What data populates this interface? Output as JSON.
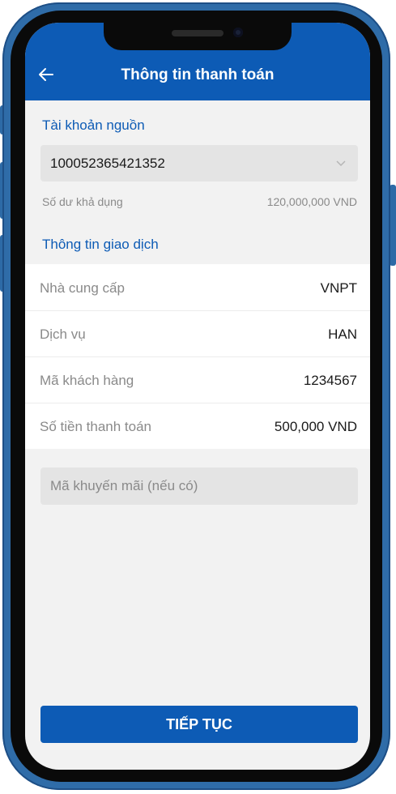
{
  "header": {
    "title": "Thông tin thanh toán",
    "back_icon": "back-arrow-icon"
  },
  "source_account": {
    "section_label": "Tài khoản nguồn",
    "account_number": "100052365421352",
    "dropdown_icon": "chevron-down-icon",
    "balance_label": "Số dư khả dụng",
    "balance_value": "120,000,000 VND"
  },
  "transaction": {
    "section_label": "Thông tin giao dịch",
    "rows": [
      {
        "label": "Nhà cung cấp",
        "value": "VNPT"
      },
      {
        "label": "Dịch vụ",
        "value": "HAN"
      },
      {
        "label": "Mã khách hàng",
        "value": "1234567"
      },
      {
        "label": "Số tiền thanh toán",
        "value": "500,000 VND"
      }
    ]
  },
  "promo": {
    "value": "",
    "placeholder": "Mã khuyến mãi (nếu có)"
  },
  "footer": {
    "continue_label": "TIẾP TỤC"
  },
  "colors": {
    "primary": "#0d5bb5",
    "frame": "#2f6ca8",
    "background": "#f2f2f2"
  }
}
